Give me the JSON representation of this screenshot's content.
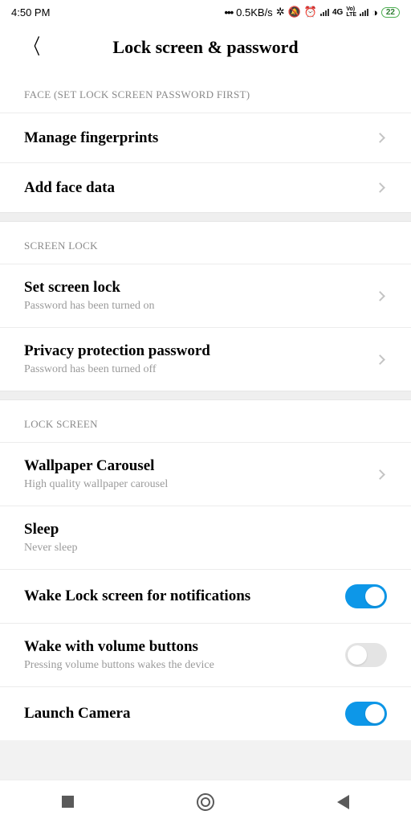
{
  "statusbar": {
    "time": "4:50 PM",
    "speed": "0.5KB/s",
    "network_label": "4G",
    "volte_label": "Vo)\nLTE",
    "battery_pct": "22"
  },
  "header": {
    "title": "Lock screen & password"
  },
  "sections": {
    "face": {
      "header": "FACE (SET LOCK SCREEN PASSWORD FIRST)",
      "manage_fingerprints": "Manage fingerprints",
      "add_face_data": "Add face data"
    },
    "screen_lock": {
      "header": "SCREEN LOCK",
      "set_screen_lock_title": "Set screen lock",
      "set_screen_lock_sub": "Password has been turned on",
      "privacy_title": "Privacy protection password",
      "privacy_sub": "Password has been turned off"
    },
    "lock_screen": {
      "header": "LOCK SCREEN",
      "wallpaper_title": "Wallpaper Carousel",
      "wallpaper_sub": "High quality wallpaper carousel",
      "sleep_title": "Sleep",
      "sleep_sub": "Never sleep",
      "wake_notif_title": "Wake Lock screen for notifications",
      "wake_notif_on": true,
      "wake_vol_title": "Wake with volume buttons",
      "wake_vol_sub": "Pressing volume buttons wakes the device",
      "wake_vol_on": false,
      "launch_camera_title": "Launch Camera",
      "launch_camera_on": true
    }
  }
}
